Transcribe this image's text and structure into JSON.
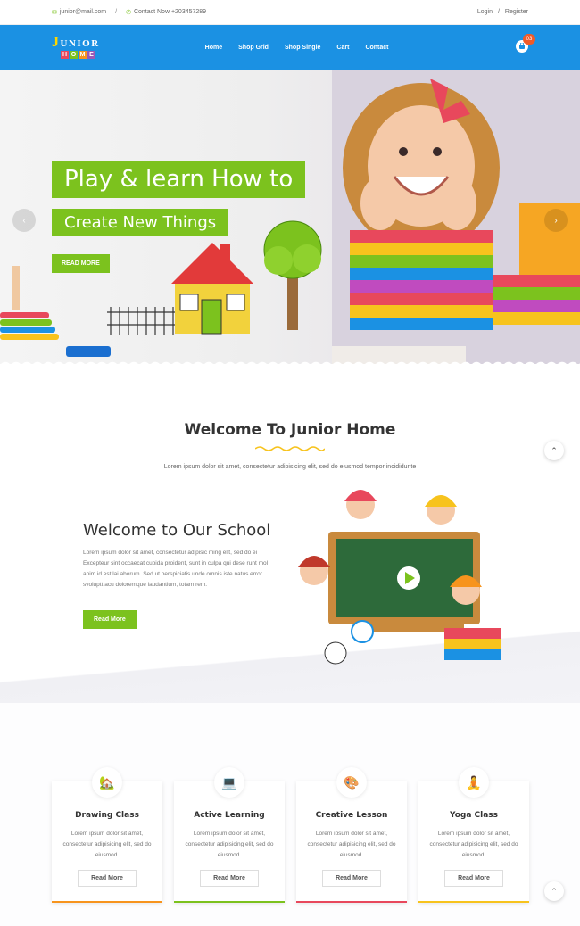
{
  "topbar": {
    "email": "junior@mail.com",
    "contact": "Contact Now +203457289",
    "login": "Login",
    "sep": "/",
    "register": "Register"
  },
  "logo": {
    "first": "J",
    "rest": "UNIOR",
    "home": [
      "H",
      "O",
      "M",
      "E"
    ]
  },
  "nav": {
    "items": [
      "Home",
      "Shop Grid",
      "Shop Single",
      "Cart",
      "Contact"
    ],
    "cart_count": "03"
  },
  "hero": {
    "line1": "Play & learn How to",
    "line2": "Create New Things",
    "button": "READ MORE"
  },
  "welcome": {
    "title": "Welcome To Junior Home",
    "subtitle": "Lorem ipsum dolor sit amet, consectetur adipisicing elit, sed do eiusmod tempor incididunte",
    "school_title": "Welcome to Our School",
    "school_text": "Lorem ipsum dolor sit amet, consectetur adipisic ming elit, sed do ei Excepteur sint occaecat cupida proident, sunt in culpa qui dese runt mol anim id est lai aborum. Sed ut perspiciatis unde omnis iste natus error svoluptt acu doloremque laudantium, totam rem.",
    "button": "Read More"
  },
  "classes": [
    {
      "title": "Drawing Class",
      "text": "Lorem ipsum dolor sit amet, consectetur adipisicing elit, sed do eiusmod.",
      "button": "Read More",
      "color": "#f7941d",
      "icon": "house-icon"
    },
    {
      "title": "Active Learning",
      "text": "Lorem ipsum dolor sit amet, consectetur adipisicing elit, sed do eiusmod.",
      "button": "Read More",
      "color": "#7cc21e",
      "icon": "computer-icon"
    },
    {
      "title": "Creative Lesson",
      "text": "Lorem ipsum dolor sit amet, consectetur adipisicing elit, sed do eiusmod.",
      "button": "Read More",
      "color": "#e8485c",
      "icon": "palette-icon"
    },
    {
      "title": "Yoga Class",
      "text": "Lorem ipsum dolor sit amet, consectetur adipisicing elit, sed do eiusmod.",
      "button": "Read More",
      "color": "#f7c31d",
      "icon": "yoga-icon"
    }
  ],
  "colors": {
    "brand_blue": "#1b91e3",
    "accent_green": "#7cc21e"
  }
}
